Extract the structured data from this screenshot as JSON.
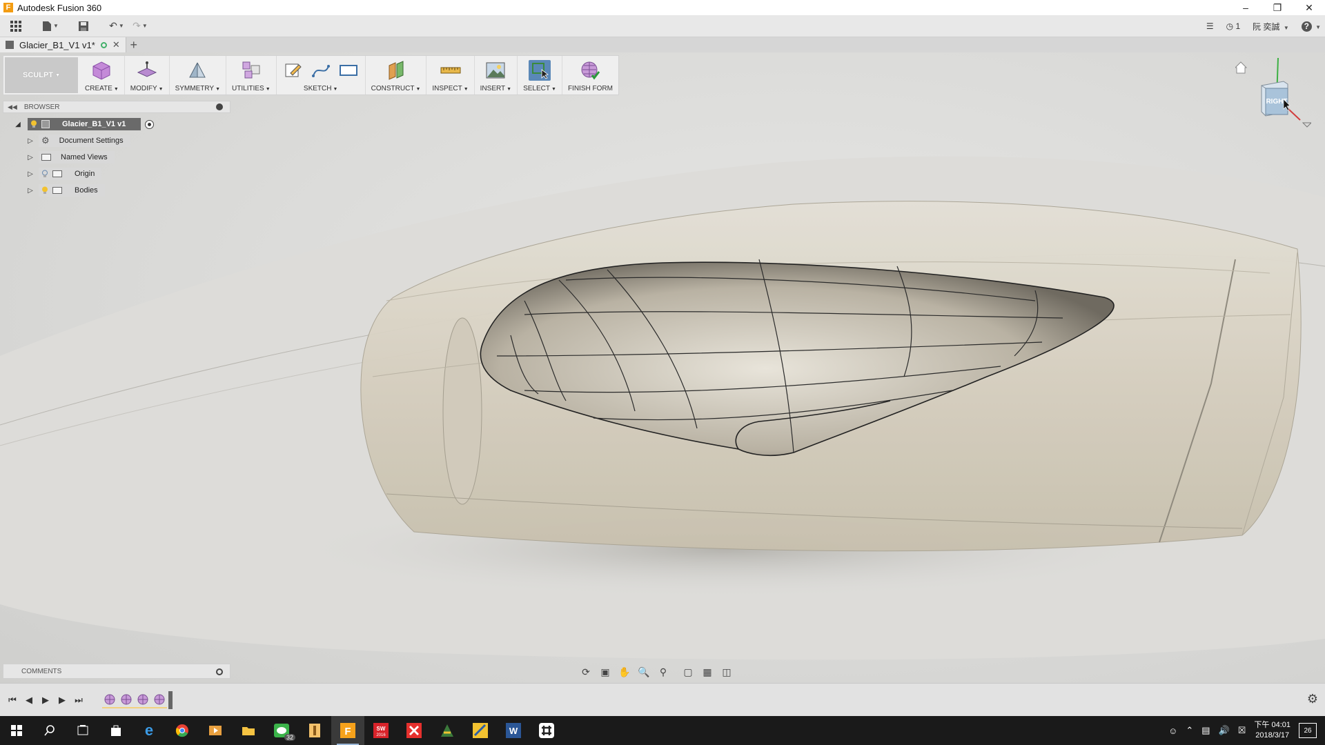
{
  "window": {
    "title": "Autodesk Fusion 360",
    "controls": [
      "minimize",
      "restore",
      "close"
    ]
  },
  "quick_access": {
    "job_status": "1",
    "user_name": "阮 奕誠",
    "help": "?"
  },
  "document_tab": {
    "name": "Glacier_B1_V1 v1*"
  },
  "toolbar": {
    "workspace": "SCULPT",
    "groups": [
      {
        "label": "CREATE"
      },
      {
        "label": "MODIFY"
      },
      {
        "label": "SYMMETRY"
      },
      {
        "label": "UTILITIES"
      },
      {
        "label": "SKETCH"
      },
      {
        "label": "CONSTRUCT"
      },
      {
        "label": "INSPECT"
      },
      {
        "label": "INSERT"
      },
      {
        "label": "SELECT"
      },
      {
        "label": "FINISH FORM"
      }
    ]
  },
  "browser": {
    "header": "BROWSER",
    "root": "Glacier_B1_V1 v1",
    "items": [
      {
        "label": "Document Settings",
        "icon": "gear-icon"
      },
      {
        "label": "Named Views",
        "icon": "folder-icon"
      },
      {
        "label": "Origin",
        "icon": "folder-icon"
      },
      {
        "label": "Bodies",
        "icon": "folder-icon"
      }
    ]
  },
  "viewcube": {
    "face": "RIGHT"
  },
  "comments": {
    "header": "COMMENTS"
  },
  "timeline": {
    "feature_count": 4
  },
  "taskbar": {
    "wechat_badge": "32",
    "sw_label": "SW 2016",
    "clock_time": "下午 04:01",
    "clock_date": "2018/3/17",
    "notifications": "26"
  },
  "colors": {
    "ws_switch": "#c9c9c9",
    "select_active": "#5a88b8",
    "taskbar": "#1a1a1a",
    "model_surface": "#d8d2c3"
  }
}
